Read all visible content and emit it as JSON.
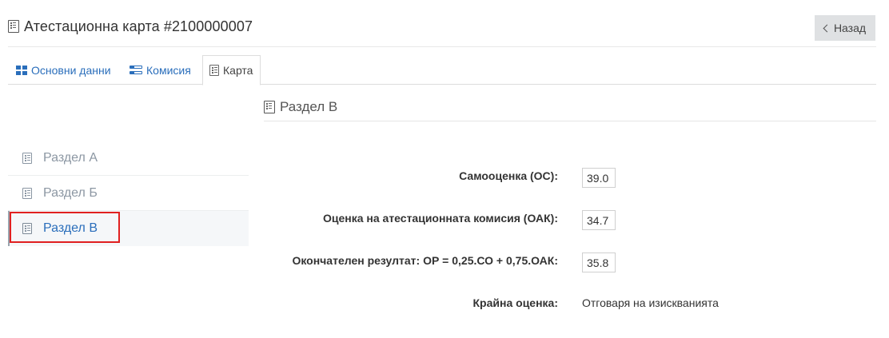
{
  "header": {
    "title": "Атестационна карта #2100000007",
    "back_label": "Назад"
  },
  "tabs": [
    {
      "label": "Основни данни",
      "icon": "grid-icon"
    },
    {
      "label": "Комисия",
      "icon": "committee-icon"
    },
    {
      "label": "Карта",
      "icon": "list-icon",
      "active": true
    }
  ],
  "sidebar": {
    "items": [
      {
        "label": "Раздел А",
        "active": false
      },
      {
        "label": "Раздел Б",
        "active": false
      },
      {
        "label": "Раздел В",
        "active": true
      }
    ]
  },
  "section": {
    "title": "Раздел В",
    "fields": [
      {
        "label": "Самооценка (ОС):",
        "value": "39.0"
      },
      {
        "label": "Оценка на атестационната комисия (ОАК):",
        "value": "34.7"
      },
      {
        "label": "Окончателен резултат: ОР = 0,25.СО + 0,75.ОАК:",
        "value": "35.8"
      },
      {
        "label": "Крайна оценка:",
        "value": "Отговаря на изискванията"
      }
    ]
  },
  "colors": {
    "link": "#2a6ebb",
    "highlight": "#e02020",
    "button_bg": "#dfe1e3"
  }
}
